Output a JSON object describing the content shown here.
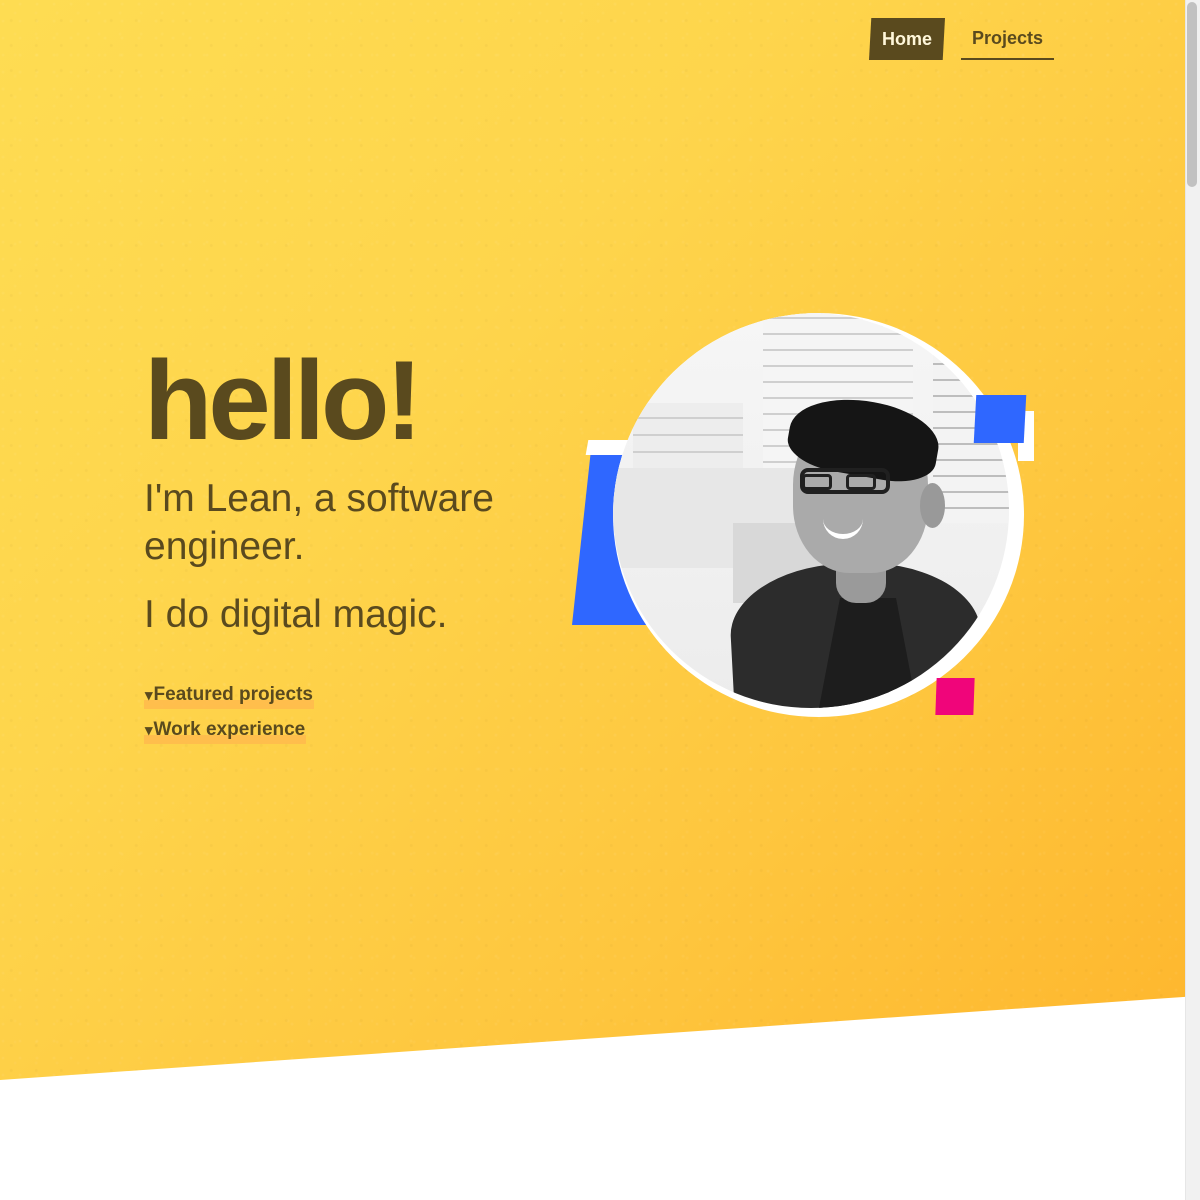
{
  "nav": {
    "items": [
      {
        "label": "Home"
      },
      {
        "label": "Projects"
      }
    ]
  },
  "hero": {
    "greeting": "hello!",
    "intro": "I'm Lean, a software engineer.",
    "tagline": "I do digital magic.",
    "links": [
      {
        "caret": "▾",
        "label": "Featured projects"
      },
      {
        "caret": "▾",
        "label": "Work experience"
      }
    ],
    "image_alt": "Black and white portrait"
  },
  "colors": {
    "accent": "#fedc52",
    "text": "#5a4a1e",
    "blue": "#2f67ff",
    "pink": "#f0057a",
    "highlight": "#ffb74d"
  },
  "icons": [
    "caret-down-icon",
    "caret-down-icon"
  ]
}
